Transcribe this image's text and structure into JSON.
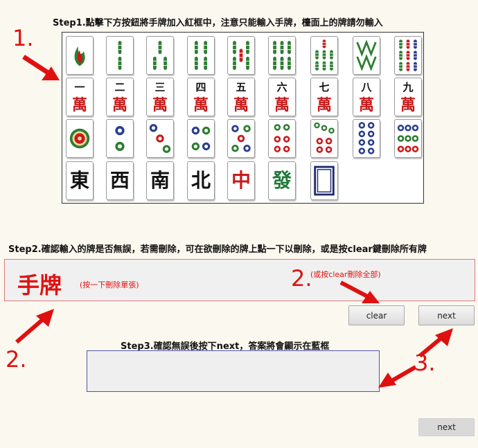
{
  "step1": {
    "text": "Step1.點擊下方按鈕將手牌加入紅框中，注意只能輸入手牌，檯面上的牌請勿輸入"
  },
  "step2": {
    "text": "Step2.確認輸入的牌是否無誤，若需刪除，可在欲刪除的牌上點一下以刪除，或是按clear鍵刪除所有牌"
  },
  "step3": {
    "text": "Step3.確認無誤後按下next，答案將會顯示在藍框"
  },
  "callouts": {
    "one": "1.",
    "two_a": "2.",
    "two_b": "2.",
    "three": "3.",
    "hand_label": "手牌",
    "hand_hint": "(按一下刪除單張)",
    "clear_hint": "(或按clear刪除全部)"
  },
  "buttons": {
    "clear": "clear",
    "next": "next",
    "next_bottom": "next"
  },
  "tiles": {
    "wan_numerals": [
      "一",
      "二",
      "三",
      "四",
      "五",
      "六",
      "七",
      "八",
      "九"
    ],
    "wan_char": "萬",
    "honors": [
      {
        "char": "東",
        "color": "#111111"
      },
      {
        "char": "西",
        "color": "#111111"
      },
      {
        "char": "南",
        "color": "#111111"
      },
      {
        "char": "北",
        "color": "#111111"
      },
      {
        "char": "中",
        "color": "#c81a1a"
      },
      {
        "char": "發",
        "color": "#1f7a3a"
      }
    ]
  },
  "colors": {
    "red": "#e01010",
    "bamboo": "#2e7d32",
    "dot_blue": "#2a3f8f",
    "dot_red": "#c81a1a"
  }
}
